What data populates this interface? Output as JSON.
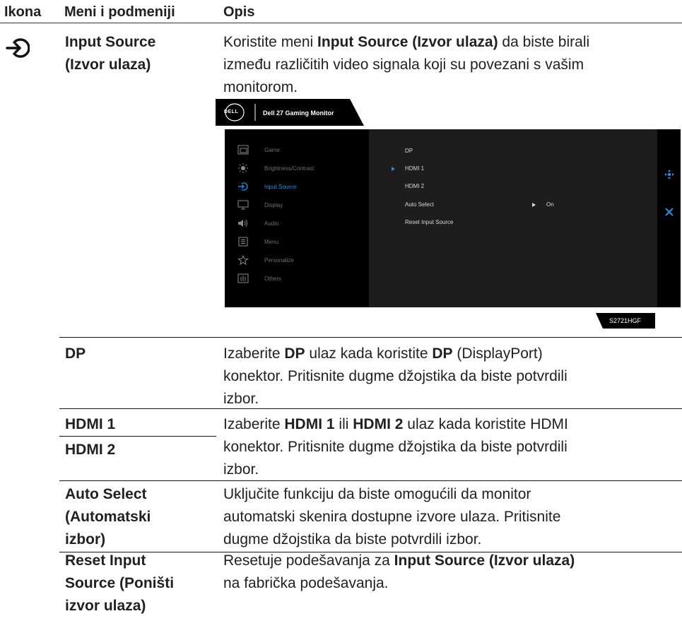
{
  "header": {
    "col_icon": "Ikona",
    "col_menu": "Meni i podmeniji",
    "col_desc": "Opis"
  },
  "input_source": {
    "name_line1": "Input Source",
    "name_line2": "(Izvor ulaza)",
    "desc_pre": "Koristite meni ",
    "desc_bold": "Input Source (Izvor ulaza)",
    "desc_post1": " da biste birali",
    "desc_line2": "između različitih video signala koji su povezani s vašim",
    "desc_line3": "monitorom."
  },
  "osd": {
    "brand": "DELL",
    "title": "Dell 27 Gaming Monitor",
    "menu": [
      "Game",
      "Brightness/Contrast",
      "Input Source",
      "Display",
      "Audio",
      "Menu",
      "Personalize",
      "Others"
    ],
    "sub": [
      "DP",
      "HDMI 1",
      "HDMI 2",
      "Auto Select",
      "Reset Input Source"
    ],
    "auto_value": "On",
    "model": "S2721HGF"
  },
  "dp": {
    "name": "DP",
    "l1_pre": "Izaberite ",
    "l1_b1": "DP",
    "l1_mid": " ulaz kada koristite ",
    "l1_b2": "DP",
    "l1_post": " (DisplayPort)",
    "l2": "konektor. Pritisnite dugme džojstika da biste potvrdili",
    "l3": "izbor."
  },
  "hdmi": {
    "name1": "HDMI 1",
    "name2": "HDMI 2",
    "l1_pre": "Izaberite ",
    "l1_b1": "HDMI 1",
    "l1_mid": " ili ",
    "l1_b2": "HDMI 2",
    "l1_post": " ulaz kada koristite HDMI",
    "l2": "konektor. Pritisnite dugme džojstika da biste potvrdili",
    "l3": "izbor."
  },
  "auto": {
    "n1": "Auto Select",
    "n2": "(Automatski",
    "n3": "izbor)",
    "l1": "Uključite funkciju da biste omogućili da monitor",
    "l2": "automatski skenira dostupne izvore ulaza. Pritisnite",
    "l3": "dugme džojstika da biste potvrdili izbor."
  },
  "reset": {
    "n1": "Reset Input",
    "n2": "Source (Poništi",
    "n3": "izvor ulaza)",
    "l1_pre": "Resetuje podešavanja za ",
    "l1_bold": "Input Source (Izvor ulaza)",
    "l2": "na fabrička podešavanja."
  }
}
